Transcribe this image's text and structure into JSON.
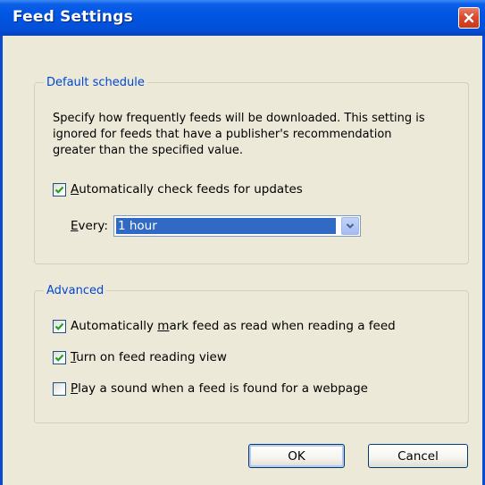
{
  "window": {
    "title": "Feed Settings"
  },
  "default_schedule": {
    "group_label": "Default schedule",
    "description": "Specify how frequently feeds will be downloaded. This setting is ignored for feeds that have a publisher's recommendation greater than the specified value.",
    "auto_check": {
      "label_mnemonic": "A",
      "label_rest": "utomatically check feeds for updates",
      "checked": true
    },
    "every": {
      "label_mnemonic": "E",
      "label_rest": "very:",
      "selected_value": "1 hour"
    }
  },
  "advanced": {
    "group_label": "Advanced",
    "mark_read": {
      "label_prefix": "Automatically ",
      "label_mnemonic": "m",
      "label_rest": "ark feed as read when reading a feed",
      "checked": true
    },
    "reading_view": {
      "label_mnemonic": "T",
      "label_rest": "urn on feed reading view",
      "checked": true
    },
    "play_sound": {
      "label_mnemonic": "P",
      "label_rest": "lay a sound when a feed is found for a webpage",
      "checked": false
    }
  },
  "buttons": {
    "ok": "OK",
    "cancel": "Cancel"
  },
  "colors": {
    "title_bar": "#0054e3",
    "group_label": "#0046d5",
    "selection": "#316ac5",
    "close_button": "#d94a2e"
  }
}
